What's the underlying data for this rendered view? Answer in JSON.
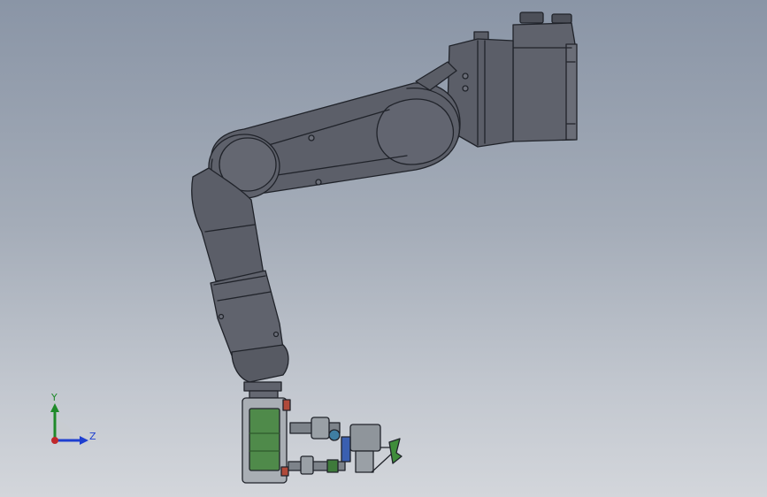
{
  "viewport": {
    "background_top": "#8a95a6",
    "background_bottom": "#d3d6db",
    "model_fill": "#5d606a",
    "model_edge": "#20232a",
    "pcb_color": "#4f8a4a"
  },
  "triad": {
    "y_label": "Y",
    "z_label": "Z",
    "y_color": "#1f8a2a",
    "z_color": "#1e3fd0",
    "origin_color": "#c0282c",
    "icons": {
      "y_axis": "y-axis-arrow-icon",
      "z_axis": "z-axis-arrow-icon",
      "origin": "origin-dot-icon"
    }
  }
}
